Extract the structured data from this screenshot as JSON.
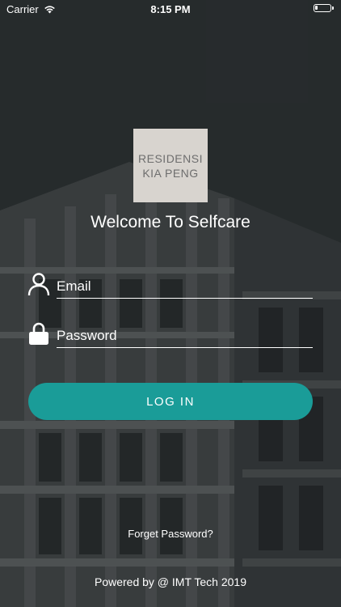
{
  "status_bar": {
    "carrier": "Carrier",
    "time": "8:15 PM",
    "battery_level": 0.2
  },
  "logo": {
    "line1": "RESIDENSI",
    "line2": "KIA PENG"
  },
  "welcome_text": "Welcome To Selfcare",
  "form": {
    "email_placeholder": "Email",
    "password_placeholder": "Password",
    "login_label": "LOG IN"
  },
  "forget_password": "Forget Password?",
  "footer": "Powered by @ IMT Tech 2019",
  "colors": {
    "accent": "#1a9c98",
    "background": "#2e3133",
    "logo_bg": "#d8d4cf"
  }
}
